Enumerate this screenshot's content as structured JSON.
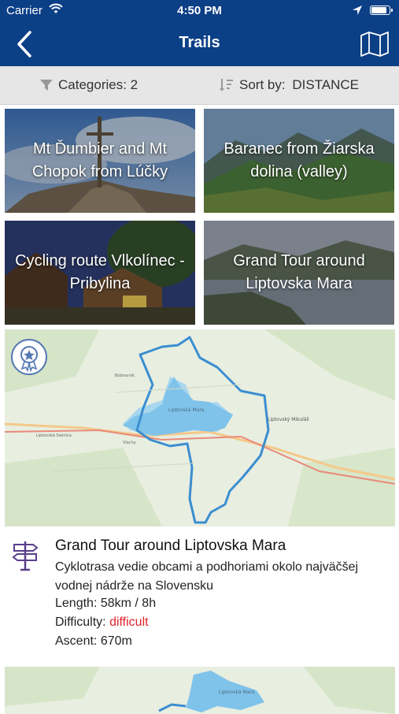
{
  "status": {
    "carrier": "Carrier",
    "time": "4:50 PM"
  },
  "nav": {
    "title": "Trails"
  },
  "filter": {
    "categories": "Categories: 2",
    "sort_label": "Sort by:",
    "sort_value": "DISTANCE"
  },
  "tiles": [
    {
      "label": "Mt Ďumbier and Mt Chopok from Lúčky"
    },
    {
      "label": "Baranec from Žiarska dolina (valley)"
    },
    {
      "label": "Cycling route Vlkolínec - Pribylina"
    },
    {
      "label": "Grand Tour around Liptovska Mara"
    }
  ],
  "featured": {
    "name": "Grand Tour around Liptovska Mara",
    "description": "Cyklotrasa vedie obcami  a podhoriami  okolo najväčšej vodnej nádrže na Slovensku",
    "length_label": "Length:",
    "length_value": "58km / 8h",
    "difficulty_label": "Difficulty:",
    "difficulty_value": "difficult",
    "ascent_label": "Ascent:",
    "ascent_value": "670m",
    "map_labels": {
      "lake": "Liptovská Mara",
      "town1": "Liptovský Mikuláš",
      "town2": "Liptovská Sielnica",
      "town3": "Bobrovník",
      "town4": "Vlachy"
    }
  },
  "map2_labels": {
    "lake": "Liptovská Mara"
  }
}
